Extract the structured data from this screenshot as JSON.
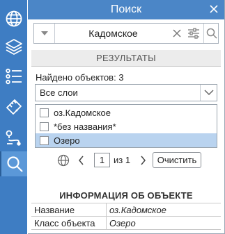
{
  "header": {
    "title": "Поиск"
  },
  "search": {
    "value": "Кадомское"
  },
  "results": {
    "section_label": "РЕЗУЛЬТАТЫ",
    "found_text": "Найдено объектов: 3",
    "layer_filter": "Все слои",
    "items": [
      {
        "label": "оз.Кадомское",
        "selected": false
      },
      {
        "label": "*без названия*",
        "selected": false
      },
      {
        "label": "Озеро",
        "selected": true
      }
    ]
  },
  "pager": {
    "page": "1",
    "of_text": "из 1",
    "clear_label": "Очистить"
  },
  "info": {
    "title": "ИНФОРМАЦИЯ ОБ ОБЪЕКТЕ",
    "rows": [
      {
        "key": "Название",
        "value": "оз.Кадомское"
      },
      {
        "key": "Класс объекта",
        "value": "Озеро"
      }
    ]
  },
  "colors": {
    "sidebar": "#3e7dc3",
    "header": "#4b86c7",
    "selected_row": "#b9d3ef"
  },
  "icons": [
    "globe-icon",
    "layers-icon",
    "list-icon",
    "ruler-icon",
    "route-icon",
    "search-icon"
  ]
}
